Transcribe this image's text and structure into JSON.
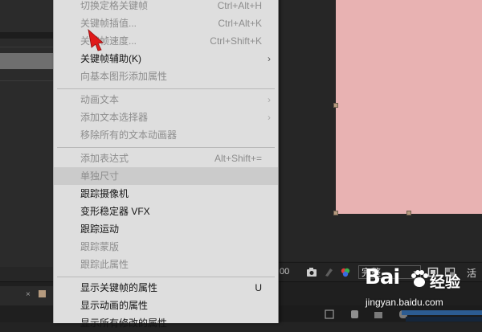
{
  "viewer": {
    "time_fragment": ":00",
    "resolution_value": "完整",
    "right_label": "活动"
  },
  "menu": {
    "items": [
      {
        "label": "切换定格关键帧",
        "shortcut": "Ctrl+Alt+H",
        "disabled": true
      },
      {
        "label": "关键帧插值...",
        "shortcut": "Ctrl+Alt+K",
        "disabled": true
      },
      {
        "label": "关键帧速度...",
        "shortcut": "Ctrl+Shift+K",
        "disabled": true
      },
      {
        "label": "关键帧辅助(K)",
        "shortcut": "",
        "disabled": false,
        "submenu": true
      },
      {
        "label": "向基本图形添加属性",
        "shortcut": "",
        "disabled": true
      },
      {
        "label": "动画文本",
        "shortcut": "",
        "disabled": true,
        "submenu": true
      },
      {
        "label": "添加文本选择器",
        "shortcut": "",
        "disabled": true,
        "submenu": true
      },
      {
        "label": "移除所有的文本动画器",
        "shortcut": "",
        "disabled": true
      },
      {
        "label": "添加表达式",
        "shortcut": "Alt+Shift+=",
        "disabled": true
      },
      {
        "label": "单独尺寸",
        "shortcut": "",
        "disabled": true,
        "highlighted": true
      },
      {
        "label": "跟踪摄像机",
        "shortcut": "",
        "disabled": false
      },
      {
        "label": "变形稳定器 VFX",
        "shortcut": "",
        "disabled": false
      },
      {
        "label": "跟踪运动",
        "shortcut": "",
        "disabled": false
      },
      {
        "label": "跟踪蒙版",
        "shortcut": "",
        "disabled": true
      },
      {
        "label": "跟踪此属性",
        "shortcut": "",
        "disabled": true
      },
      {
        "label": "显示关键帧的属性",
        "shortcut": "U",
        "disabled": false
      },
      {
        "label": "显示动画的属性",
        "shortcut": "",
        "disabled": false
      },
      {
        "label": "显示所有修改的属性",
        "shortcut": "",
        "disabled": false
      }
    ]
  },
  "timeline": {
    "close_glyph": "×"
  },
  "watermark": {
    "logo": "Bai",
    "logo_cn": "经验",
    "url": "jingyan.baidu.com"
  },
  "icons": {
    "submenu": "chevron-right-icon",
    "pointer": "red-arrow-icon",
    "camera": "camera-icon",
    "color": "color-channels-icon"
  },
  "colors": {
    "comp_fill": "#e8b2b2",
    "menu_bg": "#dedede",
    "arrow": "#e01a1a"
  }
}
